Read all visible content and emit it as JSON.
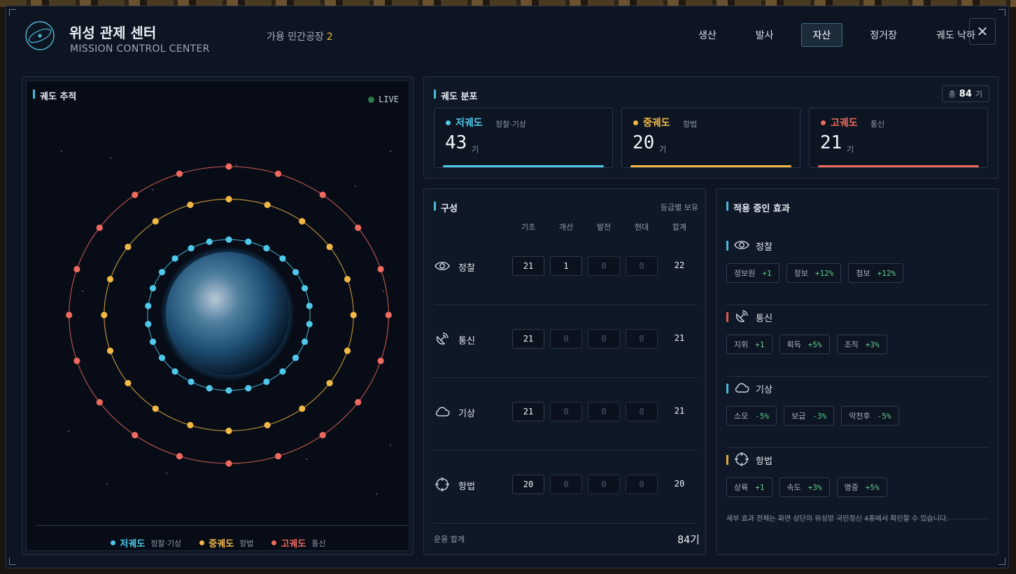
{
  "header": {
    "title": "위성 관제 센터",
    "subtitle": "MISSION CONTROL CENTER",
    "factory_label": "가용 민간공장",
    "factory_count": "2",
    "tabs": [
      "생산",
      "발사",
      "자산",
      "정거장",
      "궤도 낙하"
    ],
    "active_tab": "자산",
    "close_label": "✕"
  },
  "orbit_track": {
    "title": "궤도 추적",
    "live": "LIVE",
    "legend": [
      {
        "name": "저궤도",
        "role": "정찰·기상",
        "color": "#4fc8ea"
      },
      {
        "name": "중궤도",
        "role": "항법",
        "color": "#f2b846"
      },
      {
        "name": "고궤도",
        "role": "통신",
        "color": "#ef6a5e"
      }
    ],
    "satellite_counts": {
      "low": 26,
      "mid": 20,
      "high": 20
    }
  },
  "distribution": {
    "title": "궤도 분포",
    "total_label": "총",
    "total": "84",
    "total_unit": "기",
    "cards": [
      {
        "name": "저궤도",
        "role": "정찰·기상",
        "count": "43",
        "unit": "기",
        "color": "#4fc8ea"
      },
      {
        "name": "중궤도",
        "role": "항법",
        "count": "20",
        "unit": "기",
        "color": "#f2b846"
      },
      {
        "name": "고궤도",
        "role": "통신",
        "count": "21",
        "unit": "기",
        "color": "#ef6a5e"
      }
    ]
  },
  "composition": {
    "title": "구성",
    "note": "등급별 보유",
    "headers": [
      "기초",
      "개선",
      "발전",
      "현대",
      "합계"
    ],
    "rows": [
      {
        "label": "정찰",
        "icon": "eye-icon",
        "values": [
          "21",
          "1",
          "0",
          "0"
        ],
        "total": "22"
      },
      {
        "label": "통신",
        "icon": "satellite-dish-icon",
        "values": [
          "21",
          "0",
          "0",
          "0"
        ],
        "total": "21"
      },
      {
        "label": "기상",
        "icon": "cloud-icon",
        "values": [
          "21",
          "0",
          "0",
          "0"
        ],
        "total": "21"
      },
      {
        "label": "항법",
        "icon": "crosshair-icon",
        "values": [
          "20",
          "0",
          "0",
          "0"
        ],
        "total": "20"
      }
    ],
    "footer_label": "운용 합계",
    "footer_value": "84기"
  },
  "effects": {
    "title": "적용 중인 효과",
    "sections": [
      {
        "name": "정찰",
        "icon": "eye-icon",
        "color": "#4bb8d4",
        "chips": [
          {
            "k": "정보원",
            "v": "+1"
          },
          {
            "k": "정보",
            "v": "+12%"
          },
          {
            "k": "첩보",
            "v": "+12%"
          }
        ]
      },
      {
        "name": "통신",
        "icon": "satellite-dish-icon",
        "color": "#e05a50",
        "chips": [
          {
            "k": "지휘",
            "v": "+1"
          },
          {
            "k": "획득",
            "v": "+5%"
          },
          {
            "k": "조직",
            "v": "+3%"
          }
        ]
      },
      {
        "name": "기상",
        "icon": "cloud-icon",
        "color": "#4bb8d4",
        "chips": [
          {
            "k": "소모",
            "v": "-5%"
          },
          {
            "k": "보급",
            "v": "-3%"
          },
          {
            "k": "악천후",
            "v": "-5%"
          }
        ]
      },
      {
        "name": "항법",
        "icon": "crosshair-icon",
        "color": "#e0a640",
        "chips": [
          {
            "k": "상륙",
            "v": "+1"
          },
          {
            "k": "속도",
            "v": "+3%"
          },
          {
            "k": "명중",
            "v": "+5%"
          }
        ]
      }
    ],
    "note": "세부 효과 전체는 화면 상단의 위성망 국민정신 4종에서 확인할 수 있습니다."
  }
}
